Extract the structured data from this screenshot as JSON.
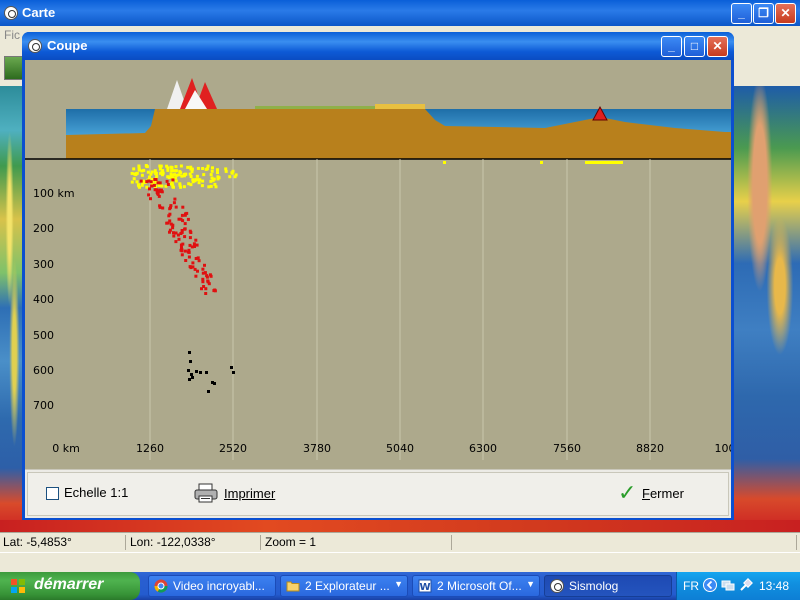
{
  "main_window": {
    "title": "Carte",
    "menu_hint": "Fic"
  },
  "dialog": {
    "title": "Coupe",
    "section": {
      "depth_labels": [
        "100 km",
        "200",
        "300",
        "400",
        "500",
        "600",
        "700"
      ],
      "distance_labels": [
        "0 km",
        "1260",
        "2520",
        "3780",
        "5040",
        "6300",
        "7560",
        "8820",
        "100"
      ],
      "colors": {
        "background": "#ada98c",
        "ocean": "#2d7fb0",
        "crust": "#b8801c",
        "shallow_quakes": "#ffff00",
        "intermediate_quakes": "#e01010",
        "deep_quakes": "#000000",
        "volcano": "#e02020"
      }
    },
    "footer": {
      "scale_checkbox_label": "Echelle 1:1",
      "scale_checked": false,
      "print_label": "Imprimer",
      "close_label_first": "F",
      "close_label_rest": "ermer"
    }
  },
  "status_bar": {
    "lat": "Lat: -5,4853°",
    "lon": "Lon: -122,0338°",
    "zoom": "Zoom = 1"
  },
  "taskbar": {
    "start_label": "démarrer",
    "tasks": [
      {
        "label": "Video incroyabl...",
        "icon": "chrome-icon"
      },
      {
        "label": "2 Explorateur ...",
        "icon": "folder-icon"
      },
      {
        "label": "2 Microsoft Of...",
        "icon": "word-icon"
      },
      {
        "label": "Sismolog",
        "icon": "sismolog-icon"
      }
    ],
    "language": "FR",
    "clock": "13:48"
  }
}
